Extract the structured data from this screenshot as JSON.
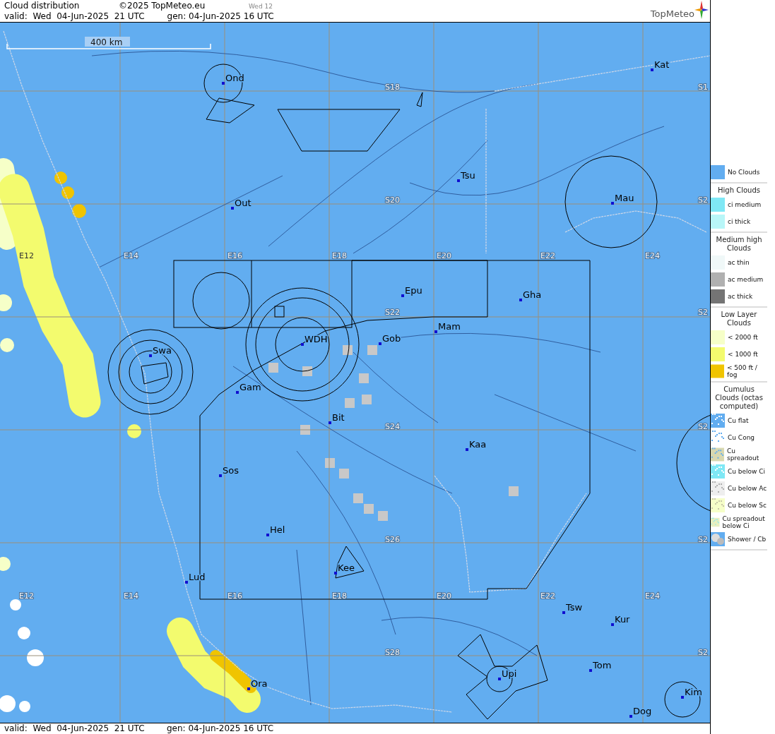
{
  "header": {
    "title": "Cloud distribution",
    "copyright": "©2025 TopMeteo.eu",
    "day_tab": "Wed 12",
    "valid": "valid:  Wed  04-Jun-2025  21 UTC",
    "gen": "gen: 04-Jun-2025 16 UTC",
    "logo": "TopMeteo"
  },
  "map": {
    "scale_label": "400 km",
    "longitude_labels_top": [
      "E12",
      "E14",
      "E16",
      "E18",
      "E20",
      "E22",
      "E24"
    ],
    "longitude_labels_bottom": [
      "E12",
      "E14",
      "E16",
      "E18",
      "E20",
      "E22",
      "E24"
    ],
    "latitude_labels": [
      "S18",
      "S20",
      "S22",
      "S24",
      "S26",
      "S28"
    ],
    "edge_latitude_labels": [
      "S1",
      "S2",
      "S2",
      "S2",
      "S2",
      "S2"
    ],
    "places": [
      {
        "name": "Ond"
      },
      {
        "name": "Kat"
      },
      {
        "name": "Tsu"
      },
      {
        "name": "Out"
      },
      {
        "name": "Mau"
      },
      {
        "name": "Epu"
      },
      {
        "name": "Gha"
      },
      {
        "name": "Mam"
      },
      {
        "name": "WDH"
      },
      {
        "name": "Gob"
      },
      {
        "name": "Swa"
      },
      {
        "name": "Gam"
      },
      {
        "name": "Bit"
      },
      {
        "name": "Kaa"
      },
      {
        "name": "Sos"
      },
      {
        "name": "Hel"
      },
      {
        "name": "Lud"
      },
      {
        "name": "Kee"
      },
      {
        "name": "Tsw"
      },
      {
        "name": "Kur"
      },
      {
        "name": "Tom"
      },
      {
        "name": "Upi"
      },
      {
        "name": "Ora"
      },
      {
        "name": "Kim"
      },
      {
        "name": "Dog"
      }
    ]
  },
  "legend": [
    {
      "items": [
        {
          "kind": "none",
          "label": "No Clouds"
        }
      ]
    },
    {
      "title": "High Clouds",
      "items": [
        {
          "kind": "ci_medium",
          "label": "ci medium"
        },
        {
          "kind": "ci_thick",
          "label": "ci thick"
        }
      ]
    },
    {
      "title": "Medium high Clouds",
      "items": [
        {
          "kind": "ac_thin",
          "label": "ac thin"
        },
        {
          "kind": "ac_medium",
          "label": "ac medium"
        },
        {
          "kind": "ac_thick",
          "label": "ac thick"
        }
      ]
    },
    {
      "title": "Low Layer Clouds",
      "items": [
        {
          "kind": "low_2000",
          "label": "< 2000 ft"
        },
        {
          "kind": "low_1000",
          "label": "< 1000 ft"
        },
        {
          "kind": "low_500",
          "label": "< 500 ft / fog"
        }
      ]
    },
    {
      "title": "Cumulus Clouds (octas computed)",
      "items": [
        {
          "kind": "cu_flat",
          "label": "Cu flat"
        },
        {
          "kind": "cu_cong",
          "label": "Cu Cong"
        },
        {
          "kind": "cu_spread",
          "label": "Cu spreadout"
        },
        {
          "kind": "cu_ci",
          "label": "Cu below Ci"
        },
        {
          "kind": "cu_ac",
          "label": "Cu below Ac"
        },
        {
          "kind": "cu_sc",
          "label": "Cu below Sc"
        },
        {
          "kind": "cu_spread_ci",
          "label": "Cu spreadout below Ci"
        },
        {
          "kind": "shower",
          "label": "Shower / Cb"
        }
      ]
    }
  ],
  "footer": {
    "valid": "valid:  Wed  04-Jun-2025  21 UTC",
    "gen": "gen: 04-Jun-2025 16 UTC"
  }
}
